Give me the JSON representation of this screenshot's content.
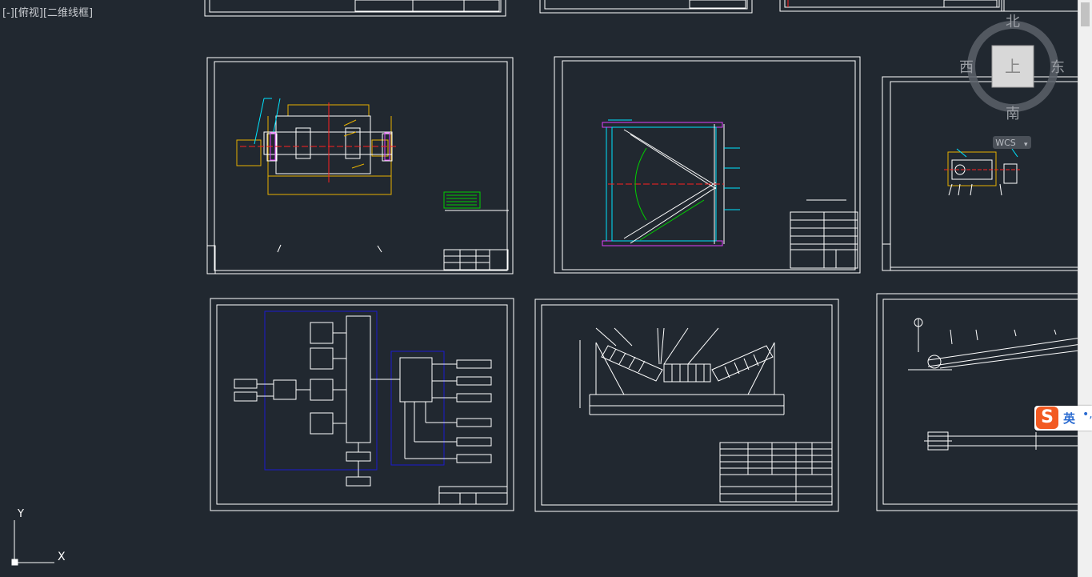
{
  "viewport": {
    "label": "[-][俯视][二维线框]"
  },
  "viewcube": {
    "north": "北",
    "south": "南",
    "east": "东",
    "west": "西",
    "face": "上",
    "wcs": "WCS"
  },
  "ucs": {
    "x_label": "X",
    "y_label": "Y"
  },
  "ime": {
    "logo": "S",
    "lang": "英",
    "extra": "•,"
  },
  "colors": {
    "background": "#212830",
    "frame": "#ffffff",
    "cyan": "#00e5ff",
    "magenta": "#e040fb",
    "yellow": "#e6b000",
    "green": "#00d000",
    "red": "#ff2020",
    "blue": "#1a1ad0"
  },
  "scrollbar": {
    "orientation": "vertical"
  }
}
